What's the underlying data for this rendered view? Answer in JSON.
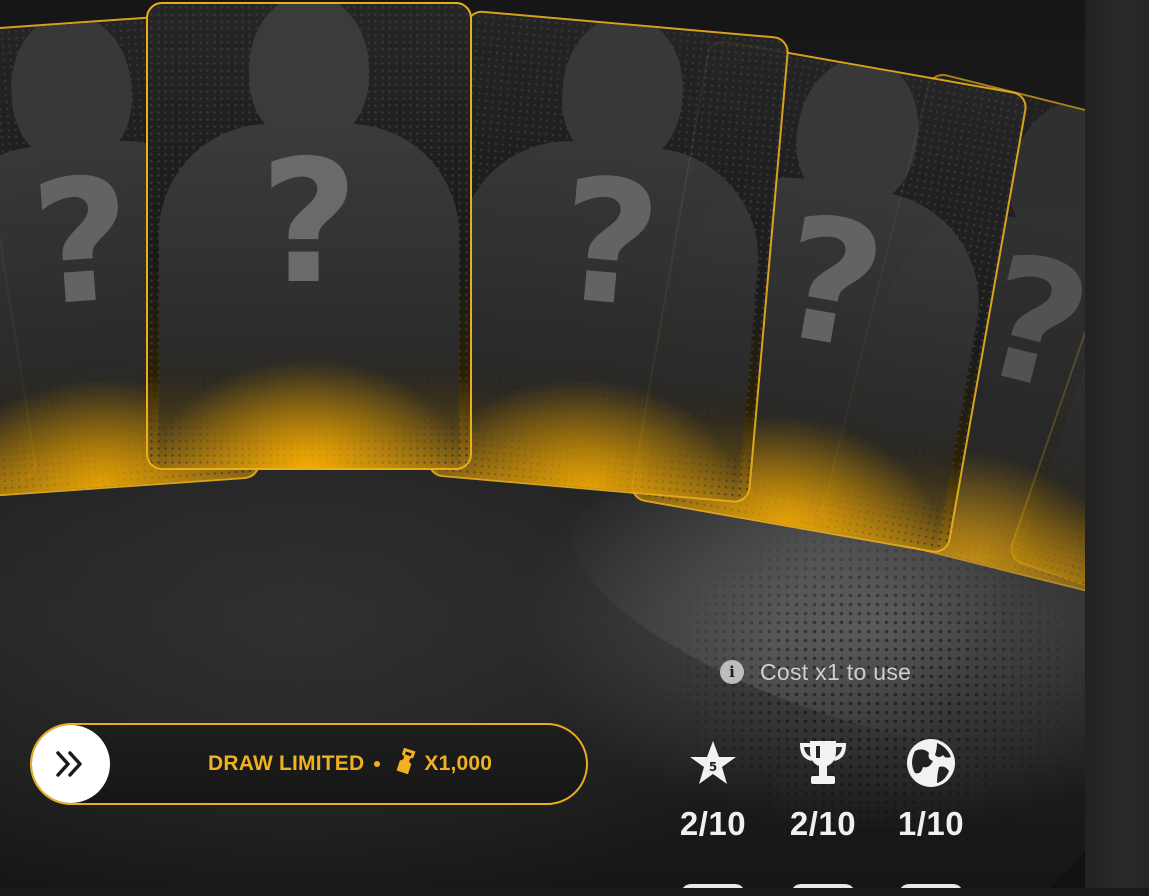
{
  "cards": [
    {
      "id": "card-far-left",
      "mark": "?"
    },
    {
      "id": "card-left",
      "mark": "?"
    },
    {
      "id": "card-center",
      "mark": "?"
    },
    {
      "id": "card-right-1",
      "mark": "?"
    },
    {
      "id": "card-right-2",
      "mark": "?"
    },
    {
      "id": "card-right-3",
      "mark": "?"
    },
    {
      "id": "card-right-4",
      "mark": "?"
    }
  ],
  "info": {
    "text": "Cost x1 to use",
    "icon": "info-icon",
    "glyph": "i"
  },
  "draw_button": {
    "label": "DRAW LIMITED",
    "cost": "X1,000",
    "arrow_icon": "double-chevron-right-icon",
    "currency_icon": "ticket-icon",
    "accent": "#e8ae1c"
  },
  "stats": [
    {
      "icon": "star-icon",
      "badge": "5",
      "value": "2/10"
    },
    {
      "icon": "trophy-icon",
      "value": "2/10"
    },
    {
      "icon": "globe-icon",
      "value": "1/10"
    }
  ],
  "colors": {
    "accent": "#e8ae1c",
    "background": "#161616",
    "text": "#f0f0f0"
  }
}
